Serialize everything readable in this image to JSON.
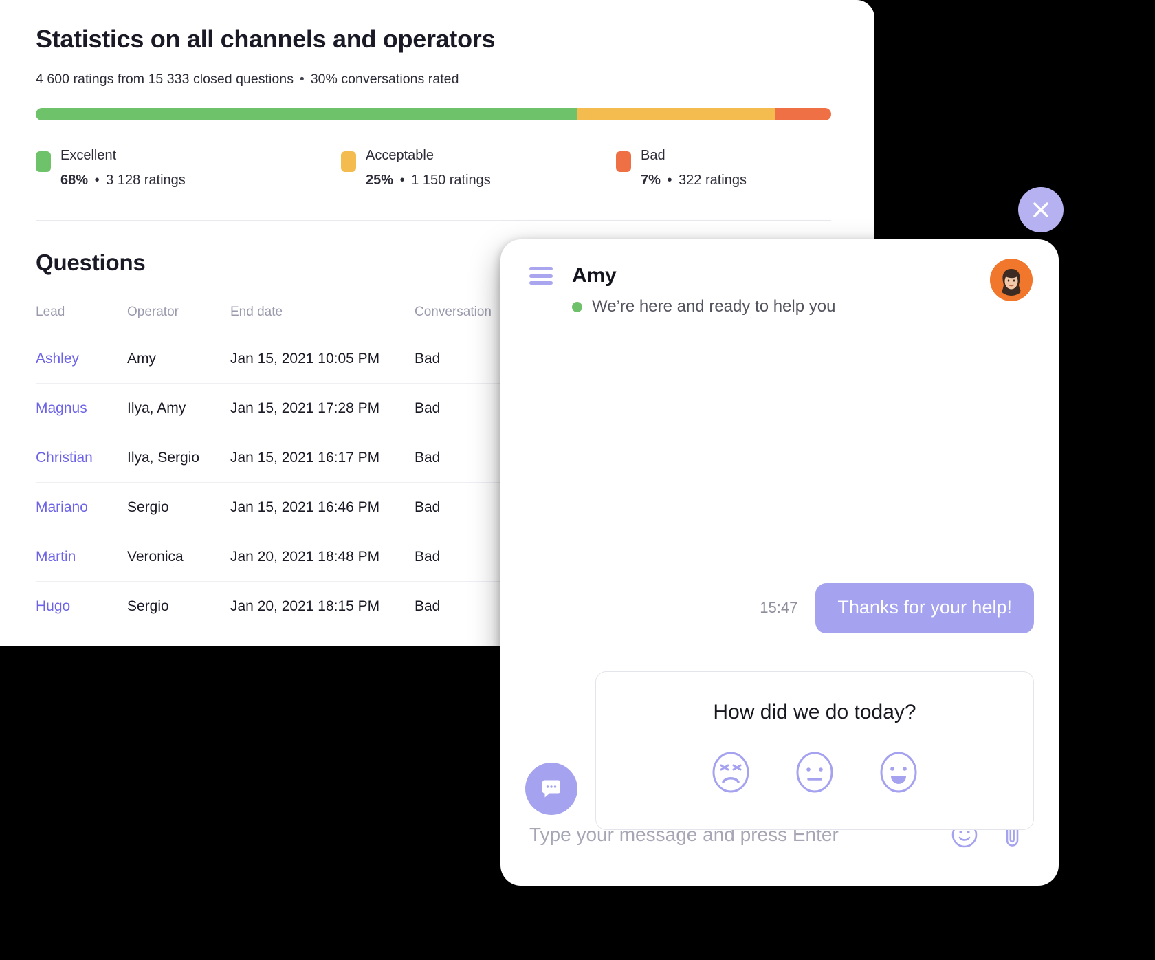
{
  "stats": {
    "title": "Statistics on all channels and operators",
    "subtitle_a": "4 600 ratings from 15 333 closed questions",
    "subtitle_sep": "•",
    "subtitle_b": "30% conversations rated",
    "bar": [
      {
        "label": "Excellent",
        "percent": "68%",
        "width": 68,
        "color": "#6ec26a"
      },
      {
        "label": "Acceptable",
        "percent": "25%",
        "width": 25,
        "color": "#f4bb4e"
      },
      {
        "label": "Bad",
        "percent": "7%",
        "width": 7,
        "color": "#ef7044"
      }
    ],
    "legend": [
      {
        "label": "Excellent",
        "percent": "68%",
        "sep": "•",
        "ratings": "3 128 ratings",
        "color": "#6ec26a"
      },
      {
        "label": "Acceptable",
        "percent": "25%",
        "sep": "•",
        "ratings": "1 150 ratings",
        "color": "#f4bb4e"
      },
      {
        "label": "Bad",
        "percent": "7%",
        "sep": "•",
        "ratings": "322 ratings",
        "color": "#ef7044"
      }
    ]
  },
  "questions": {
    "heading": "Questions",
    "columns": [
      "Lead",
      "Operator",
      "End date",
      "Conversation",
      ""
    ],
    "rows": [
      {
        "lead": "Ashley",
        "operator": "Amy",
        "end_date": "Jan 15, 2021 10:05 PM",
        "conversation": "Bad"
      },
      {
        "lead": "Magnus",
        "operator": "Ilya, Amy",
        "end_date": "Jan 15, 2021 17:28 PM",
        "conversation": "Bad"
      },
      {
        "lead": "Christian",
        "operator": "Ilya, Sergio",
        "end_date": "Jan 15, 2021 16:17 PM",
        "conversation": "Bad"
      },
      {
        "lead": "Mariano",
        "operator": "Sergio",
        "end_date": "Jan 15, 2021 16:46 PM",
        "conversation": "Bad"
      },
      {
        "lead": "Martin",
        "operator": "Veronica",
        "end_date": "Jan 20, 2021 18:48 PM",
        "conversation": "Bad"
      },
      {
        "lead": "Hugo",
        "operator": "Sergio",
        "end_date": "Jan 20, 2021 18:15 PM",
        "conversation": "Bad"
      }
    ]
  },
  "chat": {
    "close_icon": "close-icon",
    "menu_icon": "hamburger-menu-icon",
    "operator_name": "Amy",
    "status_text": "We’re here and ready to help you",
    "status_color": "#6fc06a",
    "avatar_icon": "operator-avatar",
    "message": {
      "time": "15:47",
      "text": "Thanks for your help!"
    },
    "launcher_icon": "chat-bubble-icon",
    "rating": {
      "question": "How did we do today?",
      "options": [
        {
          "name": "angry-face-icon",
          "value": "bad"
        },
        {
          "name": "neutral-face-icon",
          "value": "acceptable"
        },
        {
          "name": "happy-face-icon",
          "value": "excellent"
        }
      ]
    },
    "input": {
      "value": "",
      "placeholder": "Type your message and press Enter",
      "emoji_icon": "smiley-icon",
      "attach_icon": "paperclip-icon"
    },
    "accent": "#a5a2ef"
  }
}
